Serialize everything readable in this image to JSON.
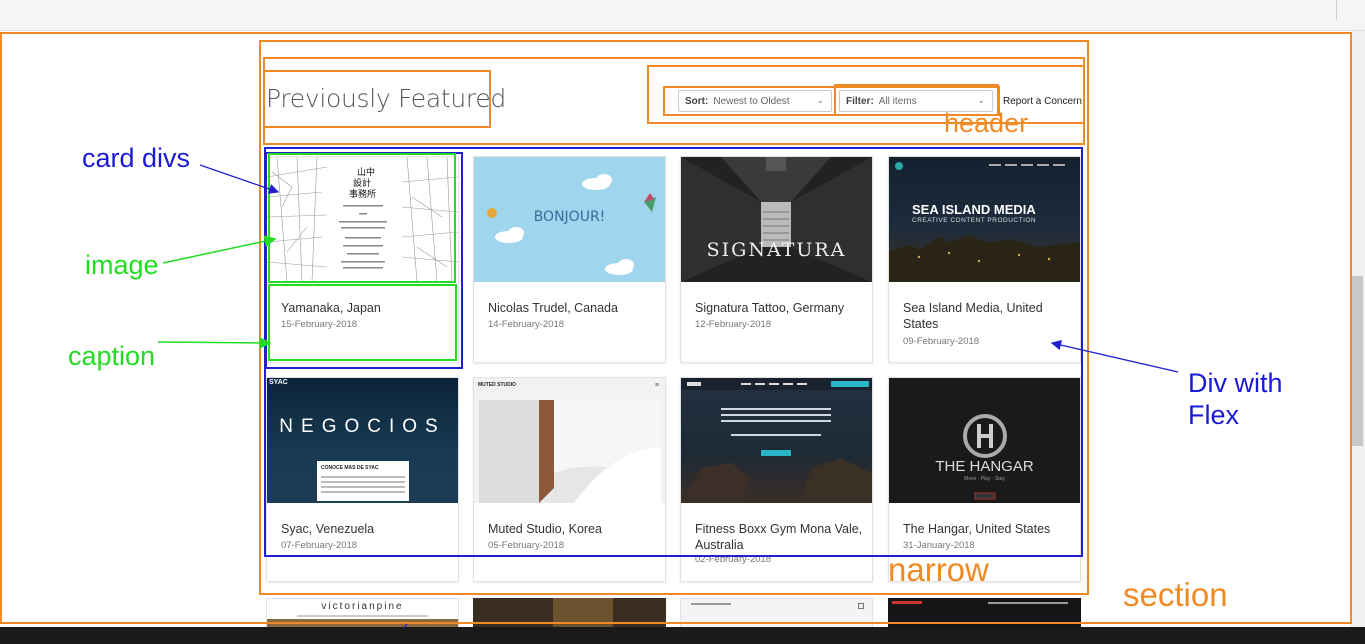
{
  "header": {
    "title": "Previously Featured",
    "sort_label": "Sort:",
    "sort_value": "Newest to Oldest",
    "filter_label": "Filter:",
    "filter_value": "All items",
    "report_link": "Report a Concern"
  },
  "annotations": {
    "card_divs": "card divs",
    "image": "image",
    "caption": "caption",
    "div_with_flex": "Div with\nFlex",
    "header": "header",
    "narrow": "narrow",
    "section": "section"
  },
  "cards": [
    {
      "name": "Yamanaka, Japan",
      "date": "15-February-2018"
    },
    {
      "name": "Nicolas Trudel, Canada",
      "date": "14-February-2018"
    },
    {
      "name": "Signatura Tattoo, Germany",
      "date": "12-February-2018"
    },
    {
      "name": "Sea Island Media, United States",
      "date": "09-February-2018"
    },
    {
      "name": "Syac, Venezuela",
      "date": "07-February-2018"
    },
    {
      "name": "Muted Studio, Korea",
      "date": "05-February-2018"
    },
    {
      "name": "Fitness Boxx Gym Mona Vale, Australia",
      "date": "02-February-2018"
    },
    {
      "name": "The Hangar, United States",
      "date": "31-January-2018"
    }
  ],
  "thumb_text": {
    "bonjour": "BONJOUR!",
    "signatura": "SIGNATURA",
    "sea_island": "SEA ISLAND MEDIA",
    "sea_island_sub": "CREATIVE CONTENT PRODUCTION",
    "negocios": "NEGOCIOS",
    "syac": "SYAC",
    "syac_box": "CONOCE MAS DE SYAC",
    "muted": "MUTED STUDIO",
    "the_hangar": "THE HANGAR",
    "hangar_sub": "Move · Play · Stay",
    "victorianpine": "victorianpine",
    "yamanaka_jp": "山中\n設計\n事務所"
  },
  "colors": {
    "annotation_orange": "#f08a24",
    "annotation_blue": "#2020d0",
    "annotation_green": "#22dd22"
  }
}
